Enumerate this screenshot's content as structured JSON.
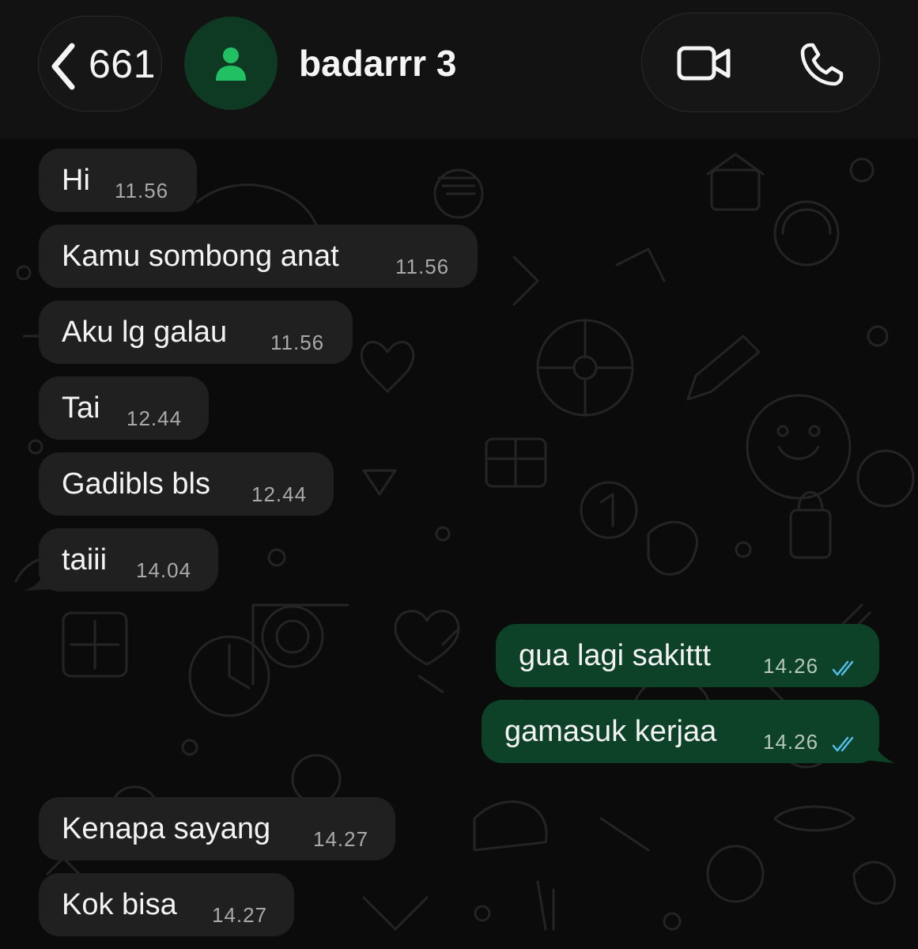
{
  "header": {
    "back_count": "661",
    "contact_name": "badarrr 3",
    "icons": {
      "back": "chevron-left-icon",
      "avatar": "person-icon",
      "video": "video-call-icon",
      "phone": "phone-icon"
    }
  },
  "colors": {
    "incoming_bubble": "#202020",
    "outgoing_bubble": "#0d4229",
    "avatar_bg": "#0e3a24",
    "avatar_icon": "#21c063",
    "read_ticks": "#53bdeb",
    "background": "#0b0b0b"
  },
  "messages": [
    {
      "direction": "incoming",
      "text": "Hi",
      "time": "11.56"
    },
    {
      "direction": "incoming",
      "text": "Kamu sombong anat",
      "time": "11.56"
    },
    {
      "direction": "incoming",
      "text": "Aku lg galau",
      "time": "11.56"
    },
    {
      "direction": "incoming",
      "text": "Tai",
      "time": "12.44"
    },
    {
      "direction": "incoming",
      "text": "Gadibls bls",
      "time": "12.44"
    },
    {
      "direction": "incoming",
      "text": "taiii",
      "time": "14.04"
    },
    {
      "direction": "outgoing",
      "text": "gua lagi sakittt",
      "time": "14.26",
      "status": "read"
    },
    {
      "direction": "outgoing",
      "text": "gamasuk kerjaa",
      "time": "14.26",
      "status": "read"
    },
    {
      "direction": "incoming",
      "text": "Kenapa sayang",
      "time": "14.27"
    },
    {
      "direction": "incoming",
      "text": "Kok bisa",
      "time": "14.27"
    }
  ]
}
